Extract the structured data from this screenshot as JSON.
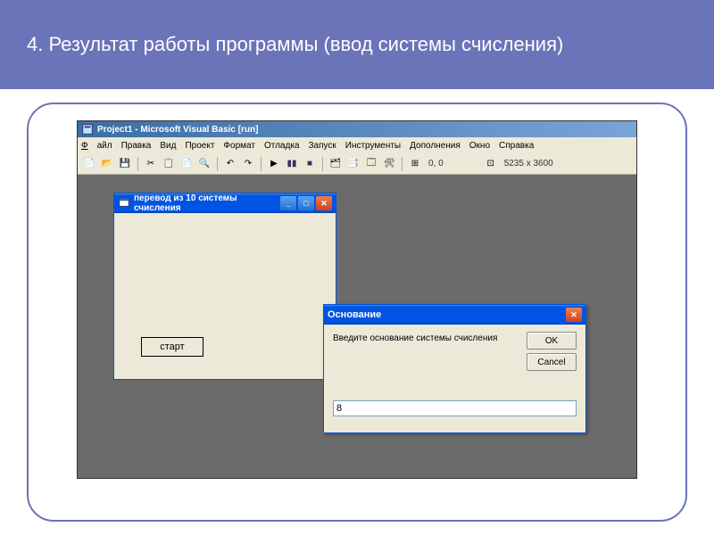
{
  "slide": {
    "title": "4. Результат работы программы (ввод системы счисления)"
  },
  "ide": {
    "title": "Project1 - Microsoft Visual Basic [run]",
    "menu": {
      "file": "Файл",
      "edit": "Правка",
      "view": "Вид",
      "project": "Проект",
      "format": "Формат",
      "debug": "Отладка",
      "run": "Запуск",
      "tools": "Инструменты",
      "addins": "Дополнения",
      "window": "Окно",
      "help": "Справка"
    },
    "toolbar": {
      "coords": "0, 0",
      "size": "5235 x 3600"
    }
  },
  "app": {
    "title": "перевод из 10 системы счисления",
    "start_label": "старт"
  },
  "dialog": {
    "title": "Основание",
    "prompt": "Введите основание системы счисления",
    "ok_label": "OK",
    "cancel_label": "Cancel",
    "input_value": "8"
  }
}
